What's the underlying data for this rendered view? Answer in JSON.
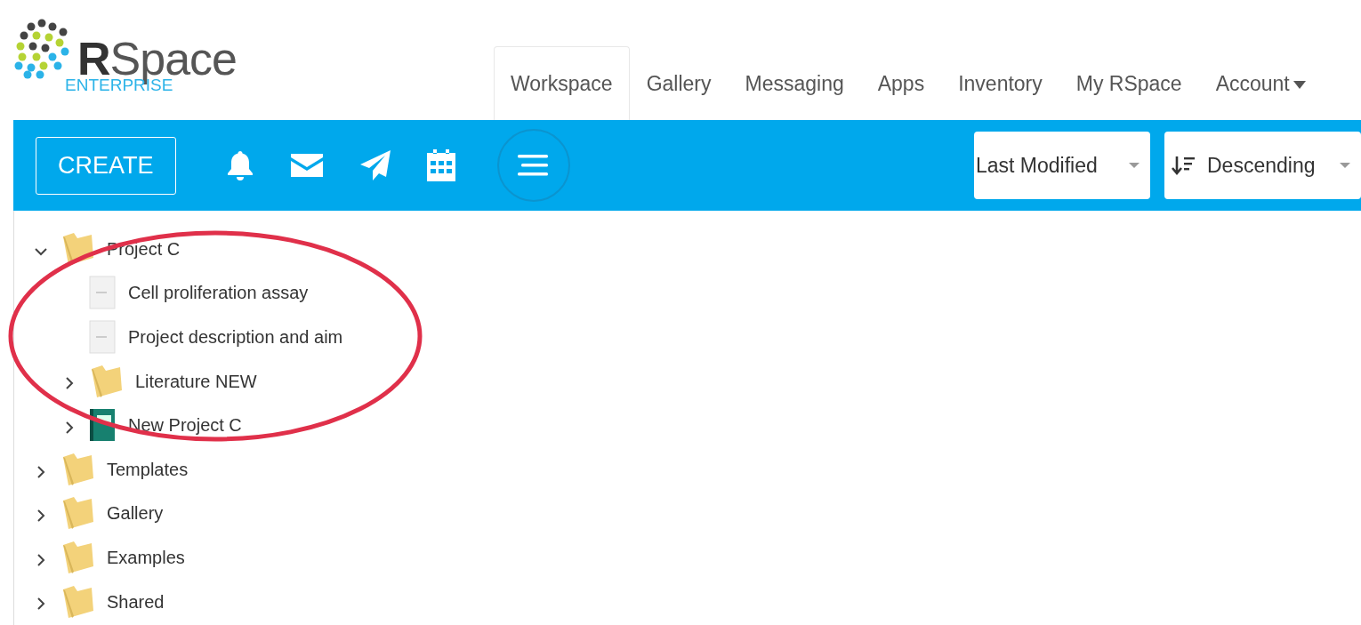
{
  "logo": {
    "name": "**R**Space",
    "edition": "ENTERPRISE"
  },
  "nav_tabs": [
    {
      "label": "Workspace",
      "selected": true,
      "dropdown": false
    },
    {
      "label": "Gallery",
      "selected": false,
      "dropdown": false
    },
    {
      "label": "Messaging",
      "selected": false,
      "dropdown": false
    },
    {
      "label": "Apps",
      "selected": false,
      "dropdown": false
    },
    {
      "label": "Inventory",
      "selected": false,
      "dropdown": false
    },
    {
      "label": "My RSpace",
      "selected": false,
      "dropdown": false
    },
    {
      "label": "Account",
      "selected": false,
      "dropdown": true
    }
  ],
  "toolbar": {
    "create_button": "CREATE",
    "sort_field": {
      "label": "Last Modified"
    },
    "sort_order": {
      "label": "Descending"
    }
  },
  "tree": [
    {
      "label": "Project C",
      "kind": "folder",
      "expanded": true,
      "children": [
        {
          "label": "Cell proliferation assay",
          "kind": "document"
        },
        {
          "label": "Project description and aim",
          "kind": "document"
        },
        {
          "label": "Literature NEW",
          "kind": "folder",
          "expanded": false
        },
        {
          "label": "New Project C",
          "kind": "notebook",
          "expanded": false
        }
      ]
    },
    {
      "label": "Templates",
      "kind": "folder",
      "expanded": false
    },
    {
      "label": "Gallery",
      "kind": "folder",
      "expanded": false
    },
    {
      "label": "Examples",
      "kind": "folder",
      "expanded": false
    },
    {
      "label": "Shared",
      "kind": "folder",
      "expanded": false
    }
  ]
}
